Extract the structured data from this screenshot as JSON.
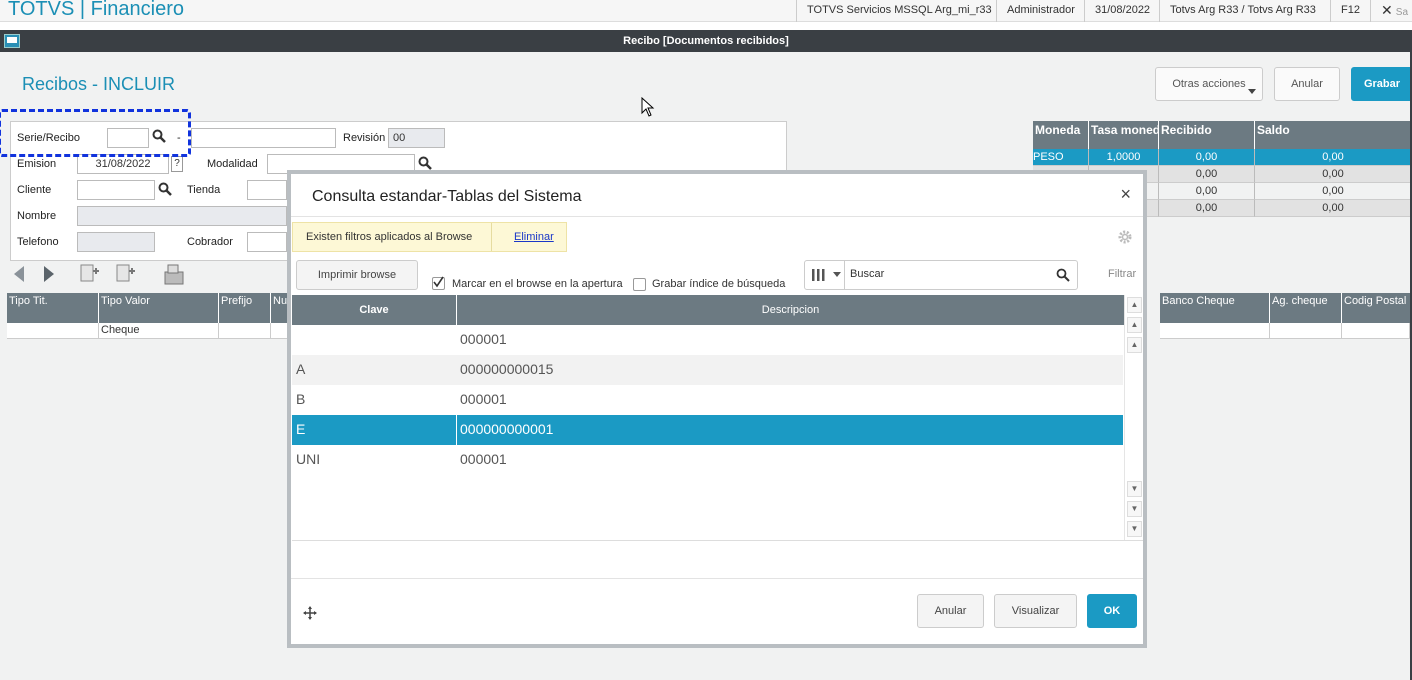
{
  "header": {
    "app_title": "TOTVS | Financiero",
    "environment": "TOTVS Servicios MSSQL Arg_mi_r33",
    "user": "Administrador",
    "date": "31/08/2022",
    "company": "Totvs Arg R33 / Totvs Arg R33",
    "f12": "F12",
    "exit": "Sa"
  },
  "window": {
    "title": "Recibo [Documentos recibidos]"
  },
  "page": {
    "title": "Recibos - INCLUIR",
    "other_actions": "Otras acciones",
    "cancel": "Anular",
    "save": "Grabar"
  },
  "form": {
    "serie_label": "Serie/Recibo",
    "dash": "-",
    "revision_label": "Revisión",
    "revision_value": "00",
    "emision_label": "Emision",
    "emision_value": "31/08/2022",
    "help": "?",
    "modalidad_label": "Modalidad",
    "cliente_label": "Cliente",
    "tienda_label": "Tienda",
    "nombre_label": "Nombre",
    "telefono_label": "Telefono",
    "cobrador_label": "Cobrador"
  },
  "currency_table": {
    "columns": [
      "Moneda",
      "Tasa moned",
      "Recibido",
      "Saldo"
    ],
    "rows": [
      [
        "PESO",
        "1,0000",
        "0,00",
        "0,00"
      ],
      [
        "",
        "",
        "0,00",
        "0,00"
      ],
      [
        "",
        "",
        "0,00",
        "0,00"
      ],
      [
        "",
        "",
        "0,00",
        "0,00"
      ]
    ]
  },
  "lower_grid": {
    "columns": [
      "Tipo Tit.",
      "Tipo Valor",
      "Prefijo",
      "Nu",
      "Banco Cheque",
      "Ag. cheque",
      "Codig Postal"
    ],
    "row": [
      "",
      "Cheque",
      "",
      "",
      "",
      "",
      ""
    ]
  },
  "modal": {
    "title": "Consulta estandar-Tablas del Sistema",
    "close": "×",
    "filter_notice": "Existen filtros aplicados al Browse",
    "filter_remove": "Eliminar",
    "print_browse": "Imprimir browse",
    "mark_on_open": "Marcar en el browse en la apertura",
    "save_index": "Grabar índice de búsqueda",
    "search_placeholder": "Buscar",
    "filter": "Filtrar",
    "columns": [
      "Clave",
      "Descripcion"
    ],
    "rows": [
      [
        "",
        "000001"
      ],
      [
        "A",
        "000000000015"
      ],
      [
        "B",
        "000001"
      ],
      [
        "E",
        "000000000001"
      ],
      [
        "UNI",
        "000001"
      ]
    ],
    "selected_row": 3,
    "cancel": "Anular",
    "view": "Visualizar",
    "ok": "OK"
  }
}
